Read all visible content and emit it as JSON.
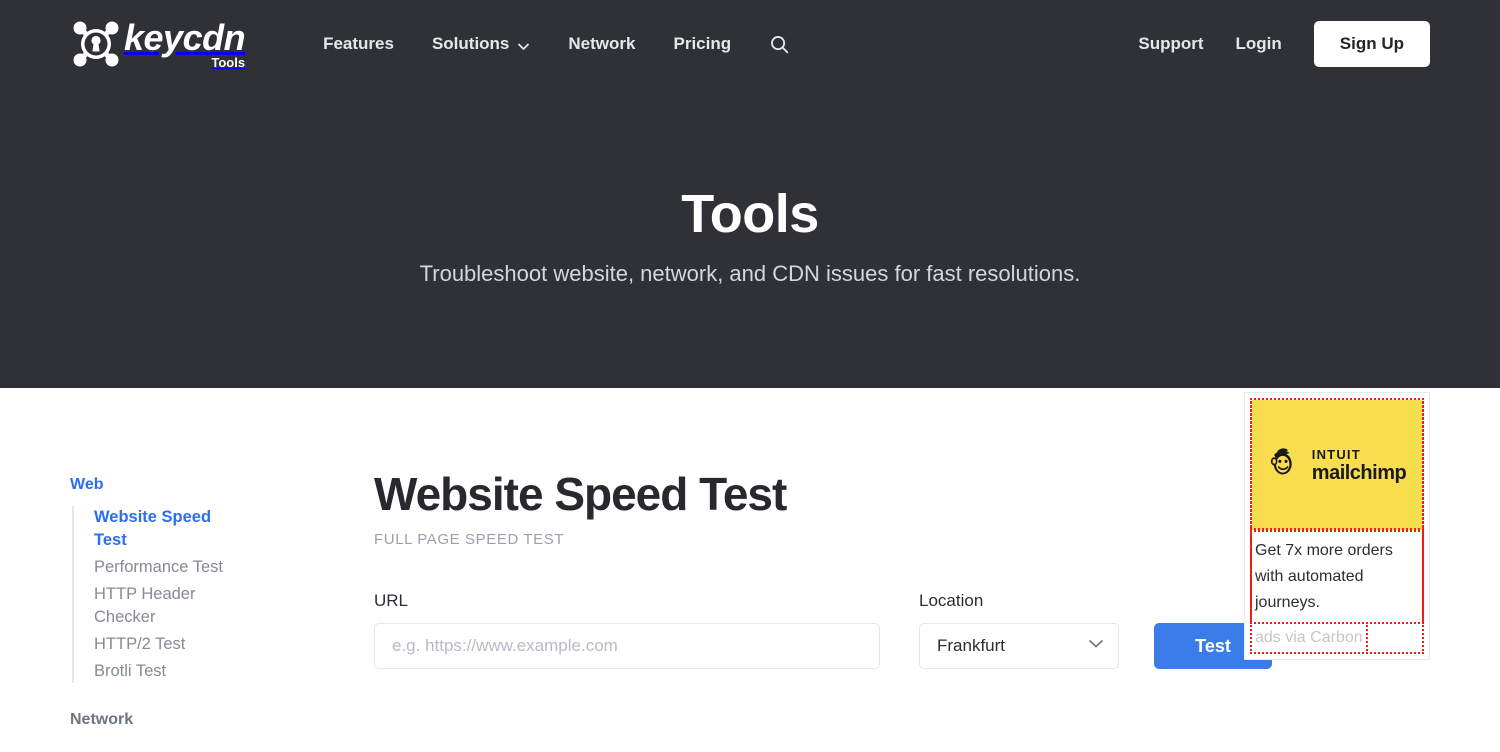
{
  "brand": {
    "name": "keycdn",
    "sub": "Tools",
    "logo_icon": "keycdn-keyhole-node-icon"
  },
  "nav": {
    "left_items": [
      {
        "label": "Features",
        "has_chevron": false
      },
      {
        "label": "Solutions",
        "has_chevron": true
      },
      {
        "label": "Network",
        "has_chevron": false
      },
      {
        "label": "Pricing",
        "has_chevron": false
      }
    ],
    "search_icon": "search-icon",
    "right_items": [
      {
        "label": "Support"
      },
      {
        "label": "Login"
      }
    ],
    "signup_label": "Sign Up"
  },
  "hero": {
    "title": "Tools",
    "subtitle": "Troubleshoot website, network, and CDN issues for fast resolutions."
  },
  "sidebar": {
    "sections": [
      {
        "heading": "Web",
        "heading_active": true,
        "items": [
          {
            "label": "Website Speed Test",
            "active": true
          },
          {
            "label": "Performance Test",
            "active": false
          },
          {
            "label": "HTTP Header Checker",
            "active": false
          },
          {
            "label": "HTTP/2 Test",
            "active": false
          },
          {
            "label": "Brotli Test",
            "active": false
          }
        ]
      },
      {
        "heading": "Network",
        "heading_active": false,
        "items": []
      }
    ]
  },
  "page": {
    "title": "Website Speed Test",
    "subtitle": "FULL PAGE SPEED TEST"
  },
  "form": {
    "url_label": "URL",
    "url_value": "",
    "url_placeholder": "e.g. https://www.example.com",
    "location_label": "Location",
    "location_value": "Frankfurt",
    "location_chevron_icon": "chevron-down-icon",
    "test_label": "Test"
  },
  "ad": {
    "logo_top": "INTUIT",
    "logo_name": "mailchimp",
    "logo_icon": "mailchimp-freddie-monkey-icon",
    "text": "Get 7x more orders with automated journeys.",
    "attribution": "ads via Carbon"
  },
  "colors": {
    "header_bg": "#303136",
    "accent_blue": "#2b6ef3",
    "button_blue": "#3b7de8",
    "ad_yellow": "#f8dd4f",
    "highlight_red": "#f01c1c",
    "text_dark": "#27292e",
    "text_muted": "#848b97"
  }
}
